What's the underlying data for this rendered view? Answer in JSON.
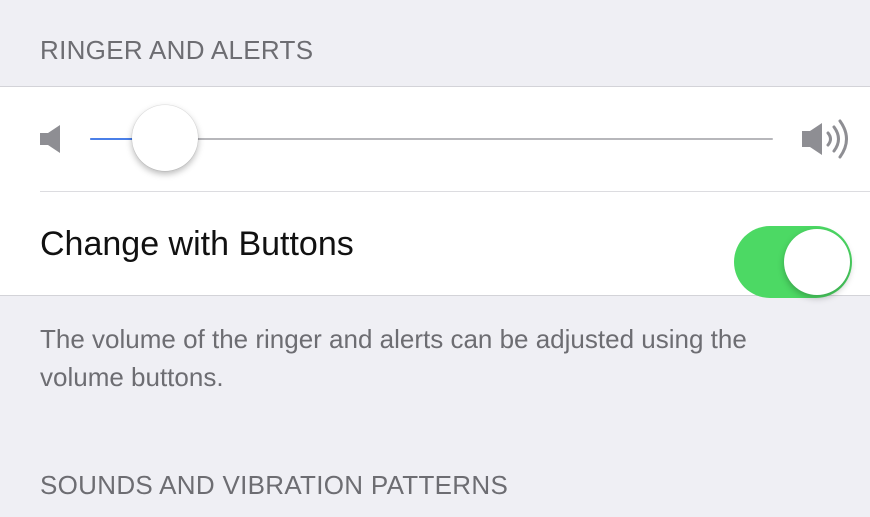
{
  "sections": {
    "ringer_header": "RINGER AND ALERTS",
    "sounds_header": "SOUNDS AND VIBRATION PATTERNS"
  },
  "volume_slider": {
    "value": 0.11,
    "min_icon": "speaker-low-icon",
    "max_icon": "speaker-high-icon",
    "fill_color": "#4a7fe8"
  },
  "change_with_buttons": {
    "label": "Change with Buttons",
    "on": true,
    "on_color": "#4cd964"
  },
  "footer": {
    "text": "The volume of the ringer and alerts can be adjusted using the volume buttons."
  }
}
